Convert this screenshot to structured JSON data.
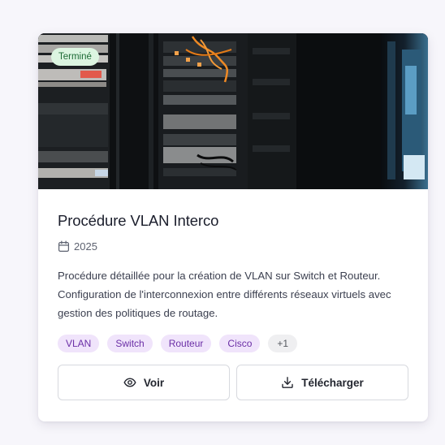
{
  "card": {
    "status": "Terminé",
    "title": "Procédure VLAN Interco",
    "year": "2025",
    "description": "Procédure détaillée pour la création de VLAN sur Switch et Routeur. Configuration de l'interconnexion entre différents réseaux virtuels avec gestion des politiques de routage.",
    "tags": [
      "VLAN",
      "Switch",
      "Routeur",
      "Cisco"
    ],
    "more_tags": "+1",
    "actions": {
      "view_label": "Voir",
      "download_label": "Télécharger"
    }
  },
  "colors": {
    "status_bg": "#dcf5e1",
    "status_text": "#1e6b36",
    "tag_bg": "#f0e4fb",
    "tag_text": "#6b2fa6"
  },
  "icons": {
    "date": "calendar-icon",
    "view": "eye-icon",
    "download": "download-icon"
  }
}
